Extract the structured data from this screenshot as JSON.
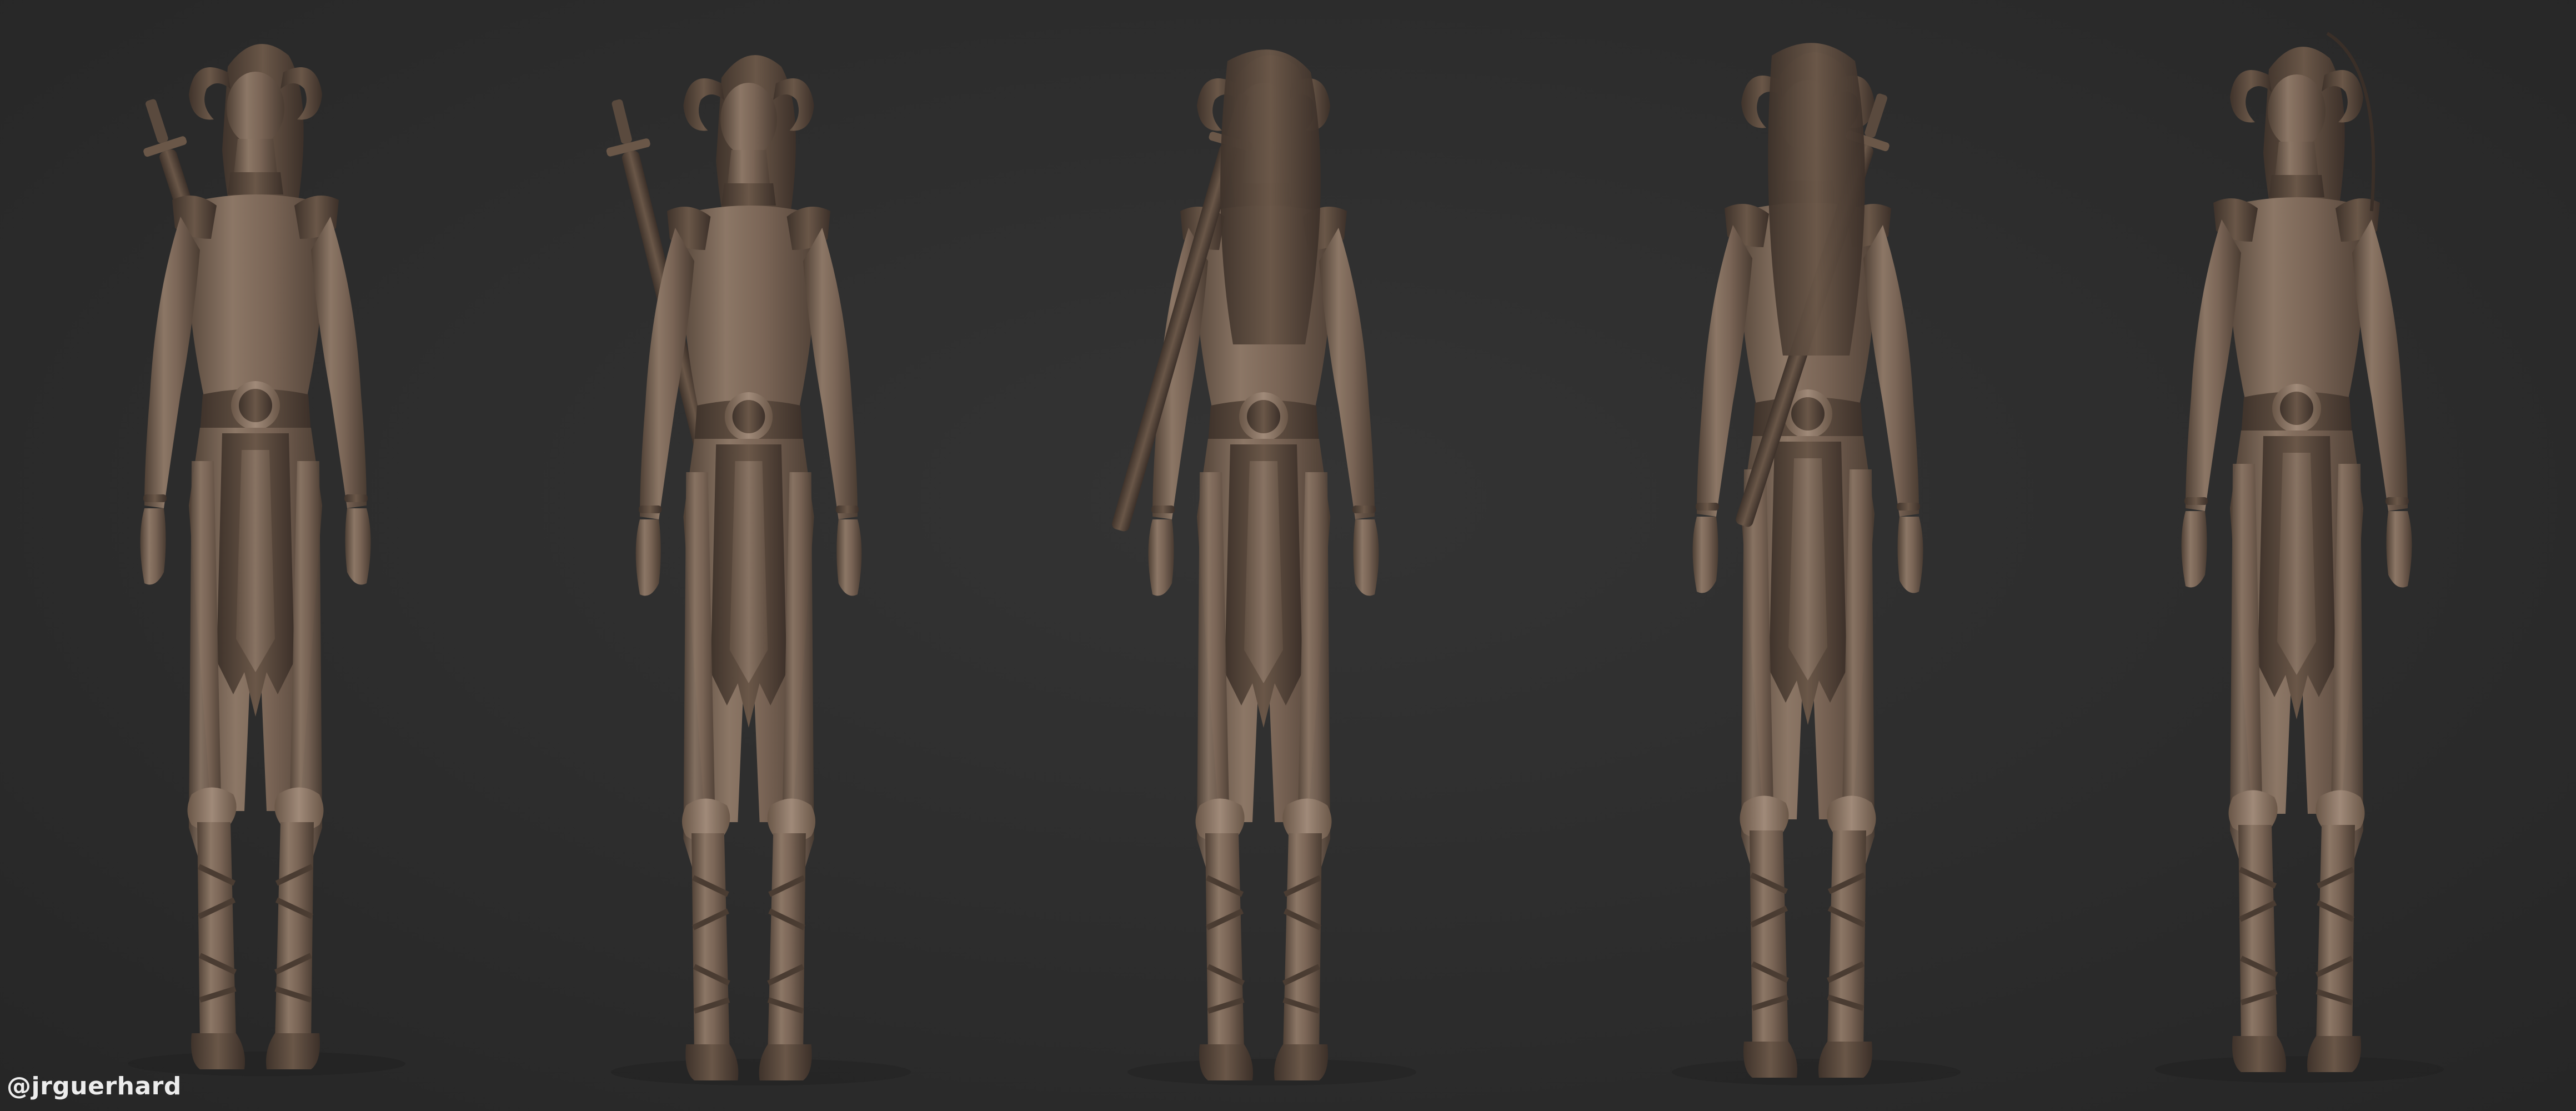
{
  "image": {
    "background_color": "#2d2d2d",
    "model_color": "#7a6556",
    "model_shadow_color": "#4f4035",
    "model_highlight_color": "#9a8474",
    "credit_color": "#ececec",
    "views": [
      {
        "view": "front"
      },
      {
        "view": "three-quarter-right"
      },
      {
        "view": "back"
      },
      {
        "view": "back-three-quarter"
      },
      {
        "view": "three-quarter-left"
      }
    ]
  },
  "watermark": {
    "credit": "@jrguerhard"
  }
}
